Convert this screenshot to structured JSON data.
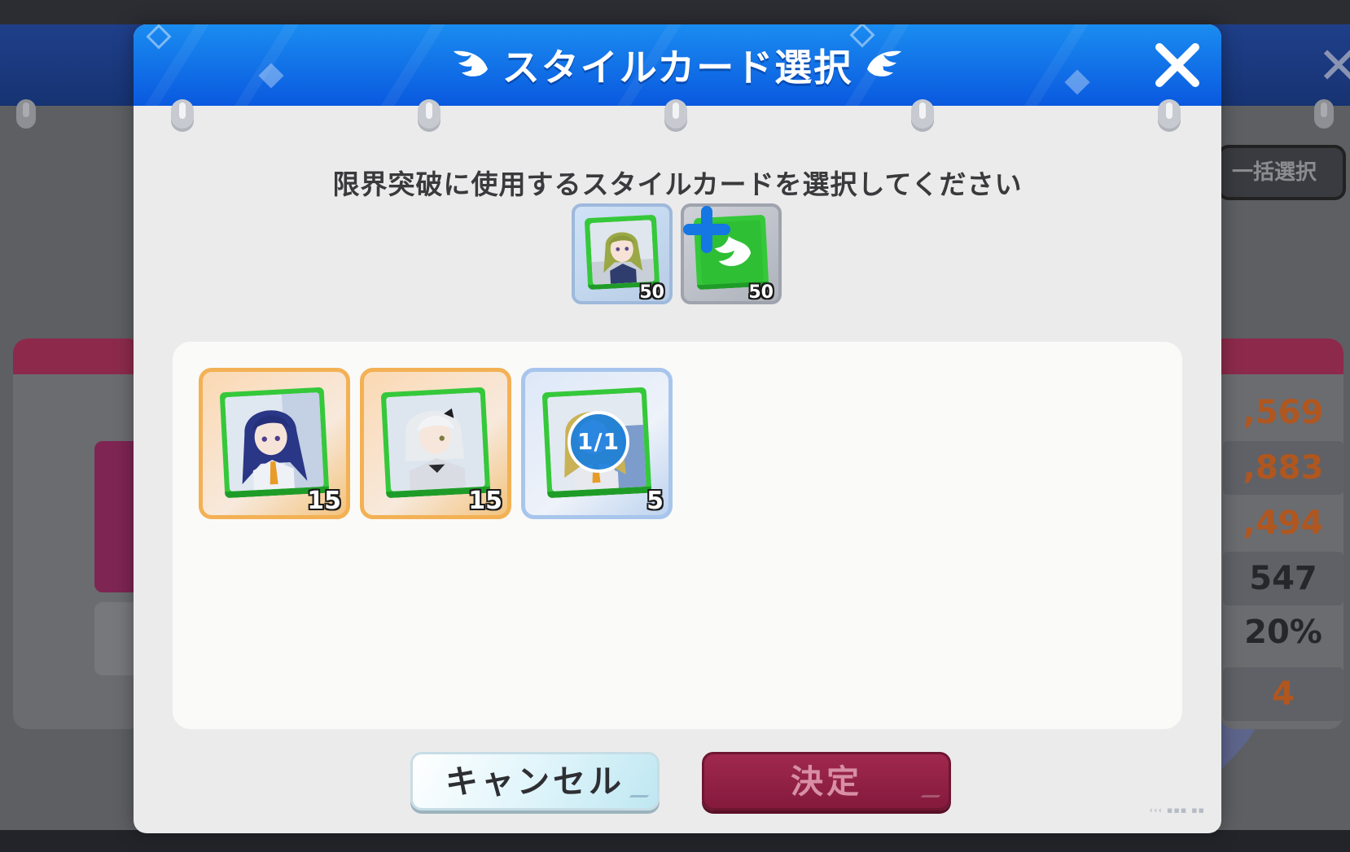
{
  "background": {
    "bulk_select_label": "一括選択",
    "stats": [
      ",569",
      ",883",
      ",494",
      "547",
      "20%",
      "4"
    ]
  },
  "modal": {
    "title": "スタイルカード選択",
    "instruction": "限界突破に使用するスタイルカードを選択してください",
    "close_label": "✕"
  },
  "target_cards": [
    {
      "level": "50",
      "portrait": "green-hair-student"
    },
    {
      "level": "50",
      "portrait": "wing-emblem"
    }
  ],
  "card_list": [
    {
      "level": "15",
      "rarity": "gold",
      "portrait": "navy-hair-student"
    },
    {
      "level": "15",
      "rarity": "gold",
      "portrait": "white-hair-student"
    },
    {
      "level": "5",
      "rarity": "blue",
      "portrait": "blonde-hair-student",
      "selected_count": "1/1"
    }
  ],
  "buttons": {
    "cancel": "キャンセル",
    "confirm": "決定"
  },
  "colors": {
    "header_blue": "#0a59df",
    "card_green": "#35c83a",
    "confirm_red": "#841a3d",
    "gold_border": "#f3b155",
    "blue_border": "#a8c5ec"
  }
}
